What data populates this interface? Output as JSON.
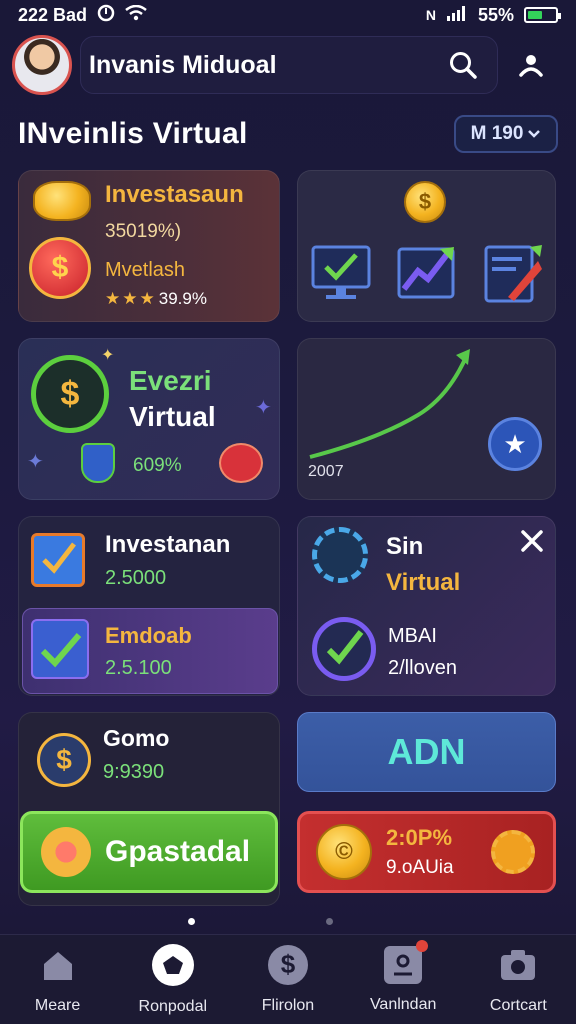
{
  "status_bar": {
    "time": "222 Bad",
    "battery": "55%",
    "battery_level": 0.55
  },
  "header": {
    "user_name": "Invanis Miduoal"
  },
  "page": {
    "title": "INveinlis Virtual",
    "dropdown_value": "M 190"
  },
  "cards": {
    "card1": {
      "title": "Investasaun",
      "value": "35019%)",
      "label": "Mvetlash",
      "rating": "39.9%",
      "stars": 3
    },
    "card2": {
      "coin_symbol": "$"
    },
    "card3": {
      "title_line1": "Evezri",
      "title_line2": "Virtual",
      "value": "609%"
    },
    "card4": {
      "label": "2007",
      "trend": "up"
    },
    "card5": {
      "title": "Investanan",
      "value": "2.5000",
      "sub_title": "Emdoab",
      "sub_value": "2.5.100"
    },
    "card6": {
      "title_line1": "Sin",
      "title_line2": "Virtual",
      "label": "MBAI",
      "value": "2/lloven"
    },
    "card7": {
      "title": "Gomo",
      "value": "9:9390"
    },
    "card8": {
      "label": "ADN"
    },
    "card9": {
      "label": "Gpastadal"
    },
    "card10": {
      "label": "2:0P%",
      "value": "9.oAUia"
    }
  },
  "pager": {
    "count": 2,
    "active": 0
  },
  "bottom_nav": [
    {
      "label": "Meare",
      "icon": "home-icon"
    },
    {
      "label": "Ronpodal",
      "icon": "pentagon-icon"
    },
    {
      "label": "Flirolon",
      "icon": "dollar-icon"
    },
    {
      "label": "Vanlndan",
      "icon": "account-icon",
      "badge": true
    },
    {
      "label": "Cortcart",
      "icon": "camera-icon"
    }
  ],
  "colors": {
    "accent_green": "#7be07a",
    "accent_gold": "#f4b63f",
    "accent_blue": "#3c5ea8",
    "accent_red": "#c42f2f"
  }
}
